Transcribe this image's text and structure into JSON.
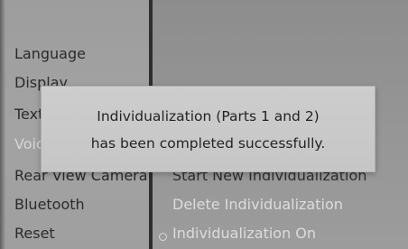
{
  "left_menu": {
    "items": [
      {
        "label": "Language",
        "selected": false
      },
      {
        "label": "Display",
        "selected": false
      },
      {
        "label": "Text Reader Speed",
        "selected": false
      },
      {
        "label": "Voice Control",
        "selected": true
      },
      {
        "label": "Rear View Camera",
        "selected": false
      },
      {
        "label": "Bluetooth",
        "selected": false
      },
      {
        "label": "Reset",
        "selected": false
      }
    ]
  },
  "right_menu": {
    "items": [
      {
        "label": "Start New Individualization",
        "enabled": true
      },
      {
        "label": "Delete Individualization",
        "enabled": false
      },
      {
        "label": "Individualization On",
        "enabled": false,
        "icon": "radio-icon"
      }
    ]
  },
  "popup": {
    "line1": "Individualization (Parts 1 and 2)",
    "line2": "has been completed successfully."
  }
}
